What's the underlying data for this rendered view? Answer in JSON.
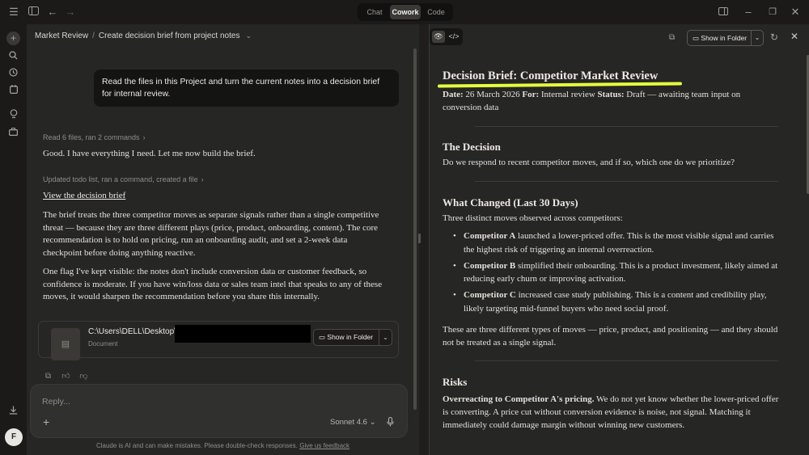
{
  "titlebar": {
    "modes": [
      {
        "label": "Chat",
        "active": false
      },
      {
        "label": "Cowork",
        "active": true
      },
      {
        "label": "Code",
        "active": false
      }
    ],
    "icons": [
      "menu-icon",
      "sidebar-toggle-icon",
      "back-arrow-icon",
      "forward-arrow-icon",
      "panel-layout-icon",
      "minimize-icon",
      "restore-icon",
      "close-icon"
    ]
  },
  "rail": {
    "icons": [
      "new-chat-icon",
      "search-icon",
      "history-icon",
      "schedule-icon",
      "lightbulb-icon",
      "projects-icon",
      "download-icon"
    ],
    "avatar_initial": "F"
  },
  "chat": {
    "breadcrumb": {
      "project": "Market Review",
      "separator": "/",
      "title": "Create decision brief from project notes"
    },
    "user_message": "Read the files in this Project and turn the current notes into a decision brief for internal review.",
    "meta1": "Read 6 files, ran 2 commands",
    "reply1": "Good. I have everything I need. Let me now build the brief.",
    "meta2": "Updated todo list, ran a command, created a file",
    "link": "View the decision brief",
    "para1": "The brief treats the three competitor moves as separate signals rather than a single competitive threat — because they are three different plays (price, product, onboarding, content). The core recommendation is to hold on pricing, run an onboarding audit, and set a 2-week data checkpoint before doing anything reactive.",
    "para2": "One flag I've kept visible: the notes don't include conversion data or customer feedback, so confidence is moderate. If you have win/loss data or sales team intel that speaks to any of these moves, it would sharpen the recommendation before you share this internally.",
    "file": {
      "path": "C:\\Users\\DELL\\Desktop\\",
      "type": "Document",
      "button": "Show in Folder"
    },
    "composer": {
      "placeholder": "Reply...",
      "model": "Sonnet 4.6"
    },
    "disclaimer": "Claude is AI and can make mistakes. Please double-check responses.",
    "feedback": "Give us feedback"
  },
  "preview": {
    "show_in_folder": "Show in Folder",
    "highlight_color": "#e5ff3f",
    "doc": {
      "title": "Decision Brief: Competitor Market Review",
      "meta": {
        "date_label": "Date:",
        "date": "26 March 2026",
        "for_label": "For:",
        "for": "Internal review",
        "status_label": "Status:",
        "status": "Draft — awaiting team input on conversion data"
      },
      "decision_heading": "The Decision",
      "decision_text": "Do we respond to recent competitor moves, and if so, which one do we prioritize?",
      "changed_heading": "What Changed (Last 30 Days)",
      "changed_intro": "Three distinct moves observed across competitors:",
      "bullets": [
        {
          "name": "Competitor A",
          "text": " launched a lower-priced offer. This is the most visible signal and carries the highest risk of triggering an internal overreaction."
        },
        {
          "name": "Competitor B",
          "text": " simplified their onboarding. This is a product investment, likely aimed at reducing early churn or improving activation."
        },
        {
          "name": "Competitor C",
          "text": " increased case study publishing. This is a content and credibility play, likely targeting mid-funnel buyers who need social proof."
        }
      ],
      "changed_outro": "These are three different types of moves — price, product, and positioning — and they should not be treated as a single signal.",
      "risks_heading": "Risks",
      "risk_bold": "Overreacting to Competitor A's pricing.",
      "risk_text": " We do not yet know whether the lower-priced offer is converting. A price cut without conversion evidence is noise, not signal. Matching it immediately could damage margin without winning new customers."
    }
  }
}
